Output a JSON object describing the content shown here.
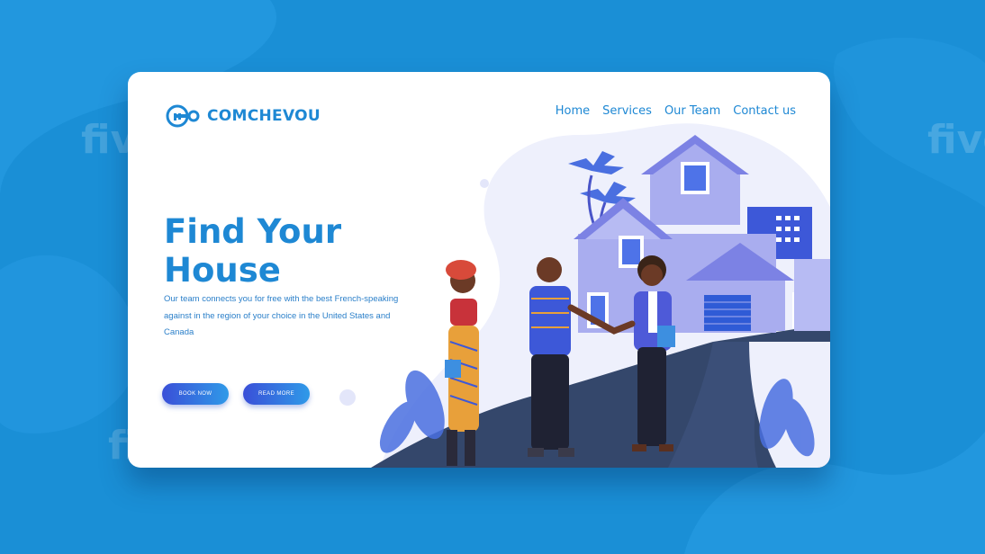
{
  "brand": {
    "name": "COMCHEVOU",
    "icon": "key-icon"
  },
  "nav": {
    "items": [
      "Home",
      "Services",
      "Our Team",
      "Contact us"
    ]
  },
  "hero": {
    "title_line1": "Find Your",
    "title_line2": "House",
    "text_line1": "Our team connects you for free with the best French-speaking",
    "text_line2": "against in the region of your choice in the United States and",
    "text_line3": "Canada"
  },
  "buttons": {
    "book": "BOOK NOW",
    "read": "READ MORE"
  },
  "watermark": "fiverr.",
  "colors": {
    "background": "#1a8fd6",
    "accent": "#1e88d4",
    "button_start": "#3a4fd8",
    "button_end": "#2f9ae8",
    "house": "#9a9ee8"
  }
}
